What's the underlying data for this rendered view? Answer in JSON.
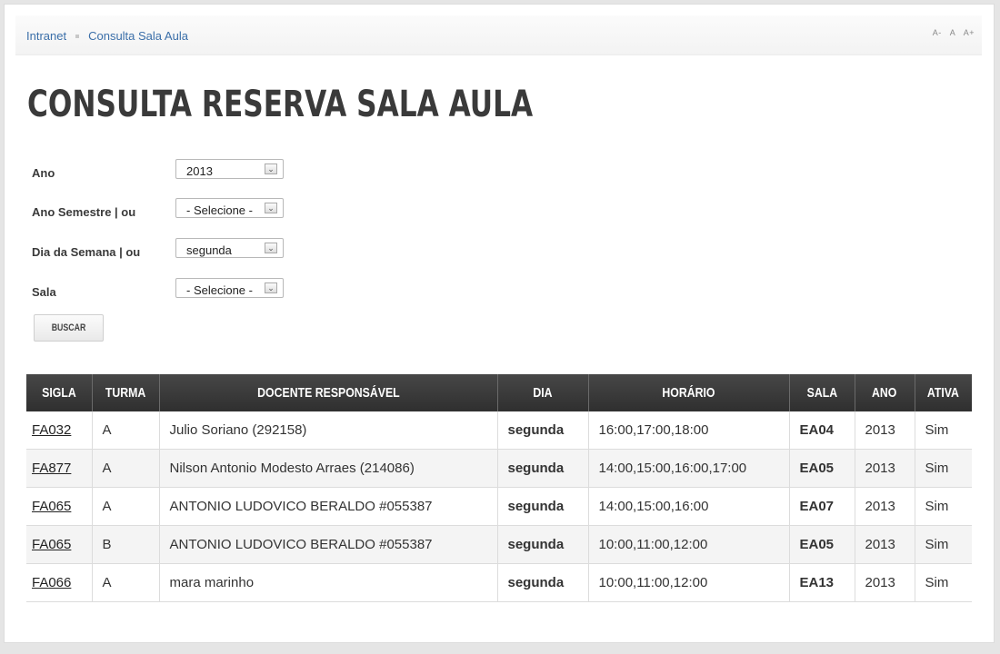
{
  "breadcrumb": {
    "home": "Intranet",
    "current": "Consulta Sala Aula"
  },
  "font_tools": {
    "decrease": "A-",
    "normal": "A",
    "increase": "A+"
  },
  "page_title": "CONSULTA RESERVA SALA AULA",
  "form": {
    "ano": {
      "label": "Ano",
      "value": "2013"
    },
    "ano_semestre": {
      "label": "Ano Semestre | ou",
      "value": "- Selecione -"
    },
    "dia_semana": {
      "label": "Dia da Semana | ou",
      "value": "segunda"
    },
    "sala": {
      "label": "Sala",
      "value": "- Selecione -"
    },
    "submit_label": "BUSCAR"
  },
  "table": {
    "headers": [
      "SIGLA",
      "TURMA",
      "DOCENTE RESPONSÁVEL",
      "DIA",
      "HORÁRIO",
      "SALA",
      "ANO",
      "ATIVA"
    ],
    "rows": [
      [
        "FA032",
        "A",
        "Julio Soriano (292158)",
        "segunda",
        "16:00,17:00,18:00",
        "EA04",
        "2013",
        "Sim"
      ],
      [
        "FA877",
        "A",
        "Nilson Antonio Modesto Arraes (214086)",
        "segunda",
        "14:00,15:00,16:00,17:00",
        "EA05",
        "2013",
        "Sim"
      ],
      [
        "FA065",
        "A",
        "ANTONIO LUDOVICO BERALDO #055387",
        "segunda",
        "14:00,15:00,16:00",
        "EA07",
        "2013",
        "Sim"
      ],
      [
        "FA065",
        "B",
        "ANTONIO LUDOVICO BERALDO #055387",
        "segunda",
        "10:00,11:00,12:00",
        "EA05",
        "2013",
        "Sim"
      ],
      [
        "FA066",
        "A",
        "mara marinho",
        "segunda",
        "10:00,11:00,12:00",
        "EA13",
        "2013",
        "Sim"
      ]
    ]
  },
  "icons": {
    "select_arrow": "chevron-down-icon"
  }
}
